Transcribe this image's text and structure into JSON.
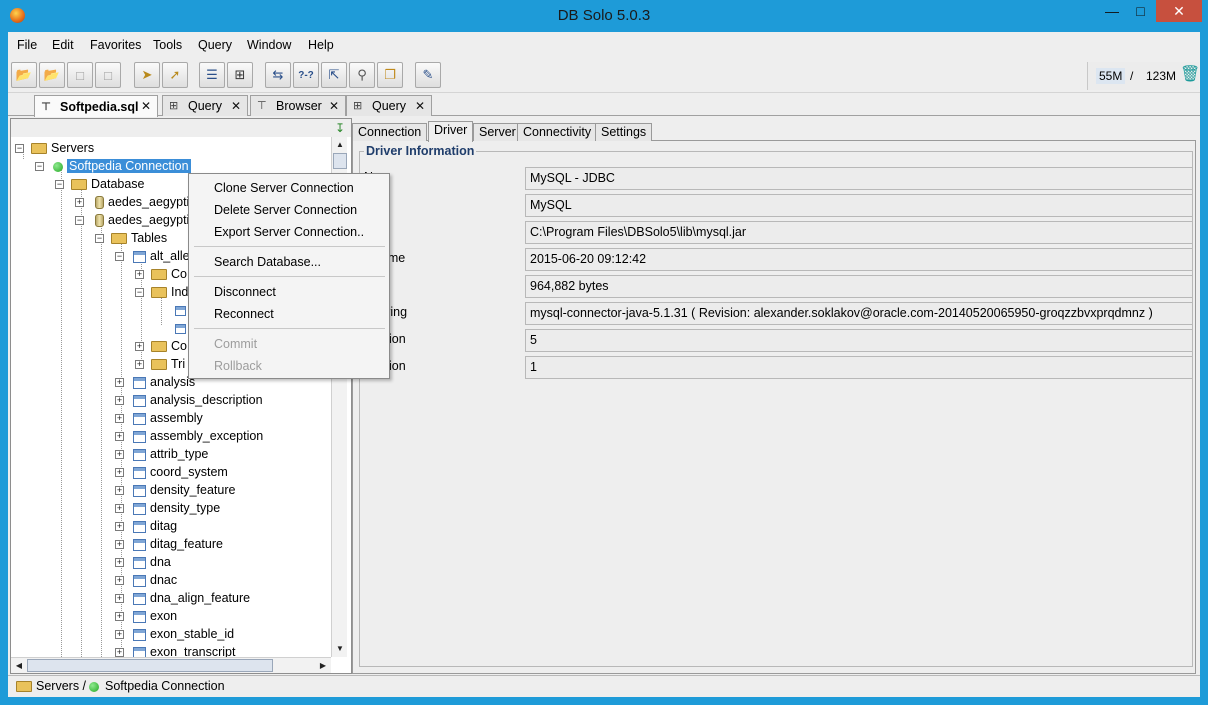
{
  "window": {
    "title": "DB Solo  5.0.3",
    "minimize": "—",
    "maximize": "□",
    "close": "✕"
  },
  "menu": [
    "File",
    "Edit",
    "Favorites",
    "Tools",
    "Query",
    "Window",
    "Help"
  ],
  "toolbar": {
    "memory_used": "55M",
    "memory_sep": "/",
    "memory_total": "123M",
    "buttons": [
      "open-icon",
      "open-remote-icon",
      "save-icon",
      "save-all-icon",
      "new-connection-icon",
      "edit-connection-icon",
      "tree-icon",
      "table-grid-icon",
      "compare-icon",
      "query-builder-icon",
      "connect-icon",
      "search-icon",
      "copy-icon",
      "sql-icon"
    ]
  },
  "editor_tabs": [
    {
      "label": "Softpedia.sql",
      "icon": "sql-file-icon",
      "active": true
    },
    {
      "label": "Query",
      "icon": "grid-icon",
      "active": false
    },
    {
      "label": "Browser",
      "icon": "tree-icon",
      "active": false
    },
    {
      "label": "Query",
      "icon": "grid-icon",
      "active": false
    }
  ],
  "tree": {
    "root": "Servers",
    "connection": "Softpedia Connection",
    "database": "Database",
    "schemas": [
      "aedes_aegypti",
      "aedes_aegypti"
    ],
    "tables_folder": "Tables",
    "first_table": "alt_alle",
    "sub_folders": [
      "Co",
      "Ind",
      "Co",
      "Tri"
    ],
    "tables": [
      "analysis",
      "analysis_description",
      "assembly",
      "assembly_exception",
      "attrib_type",
      "coord_system",
      "density_feature",
      "density_type",
      "ditag",
      "ditag_feature",
      "dna",
      "dnac",
      "dna_align_feature",
      "exon",
      "exon_stable_id",
      "exon_transcript"
    ]
  },
  "context_menu": {
    "items": [
      {
        "label": "Clone Server Connection",
        "enabled": true
      },
      {
        "label": "Delete Server Connection",
        "enabled": true
      },
      {
        "label": "Export Server Connection..",
        "enabled": true
      },
      {
        "label": "Search Database...",
        "enabled": true
      },
      {
        "label": "Disconnect",
        "enabled": true
      },
      {
        "label": "Reconnect",
        "enabled": true
      },
      {
        "label": "Commit",
        "enabled": false
      },
      {
        "label": "Rollback",
        "enabled": false
      }
    ]
  },
  "detail_tabs": [
    {
      "label": "Connection",
      "active": false
    },
    {
      "label": "Driver",
      "active": true
    },
    {
      "label": "Server",
      "active": false
    },
    {
      "label": "Connectivity",
      "active": false
    },
    {
      "label": "Settings",
      "active": false
    }
  ],
  "driver_info": {
    "title": "Driver Information",
    "rows": [
      {
        "label": "N",
        "value": "MySQL - JDBC"
      },
      {
        "label": "",
        "value": "MySQL"
      },
      {
        "label": "",
        "value": "C:\\Program Files\\DBSolo5\\lib\\mysql.jar"
      },
      {
        "label": "te/Time",
        "value": "2015-06-20 09:12:42"
      },
      {
        "label": "e",
        "value": "964,882 bytes"
      },
      {
        "label": "n String",
        "value": "mysql-connector-java-5.1.31 ( Revision: alexander.soklakov@oracle.com-20140520065950-groqzzbvxprqdmnz )"
      },
      {
        "label": "Version",
        "value": "5"
      },
      {
        "label": "Version",
        "value": "1"
      }
    ]
  },
  "status": {
    "path_root": "Servers /",
    "connection": "Softpedia Connection"
  }
}
